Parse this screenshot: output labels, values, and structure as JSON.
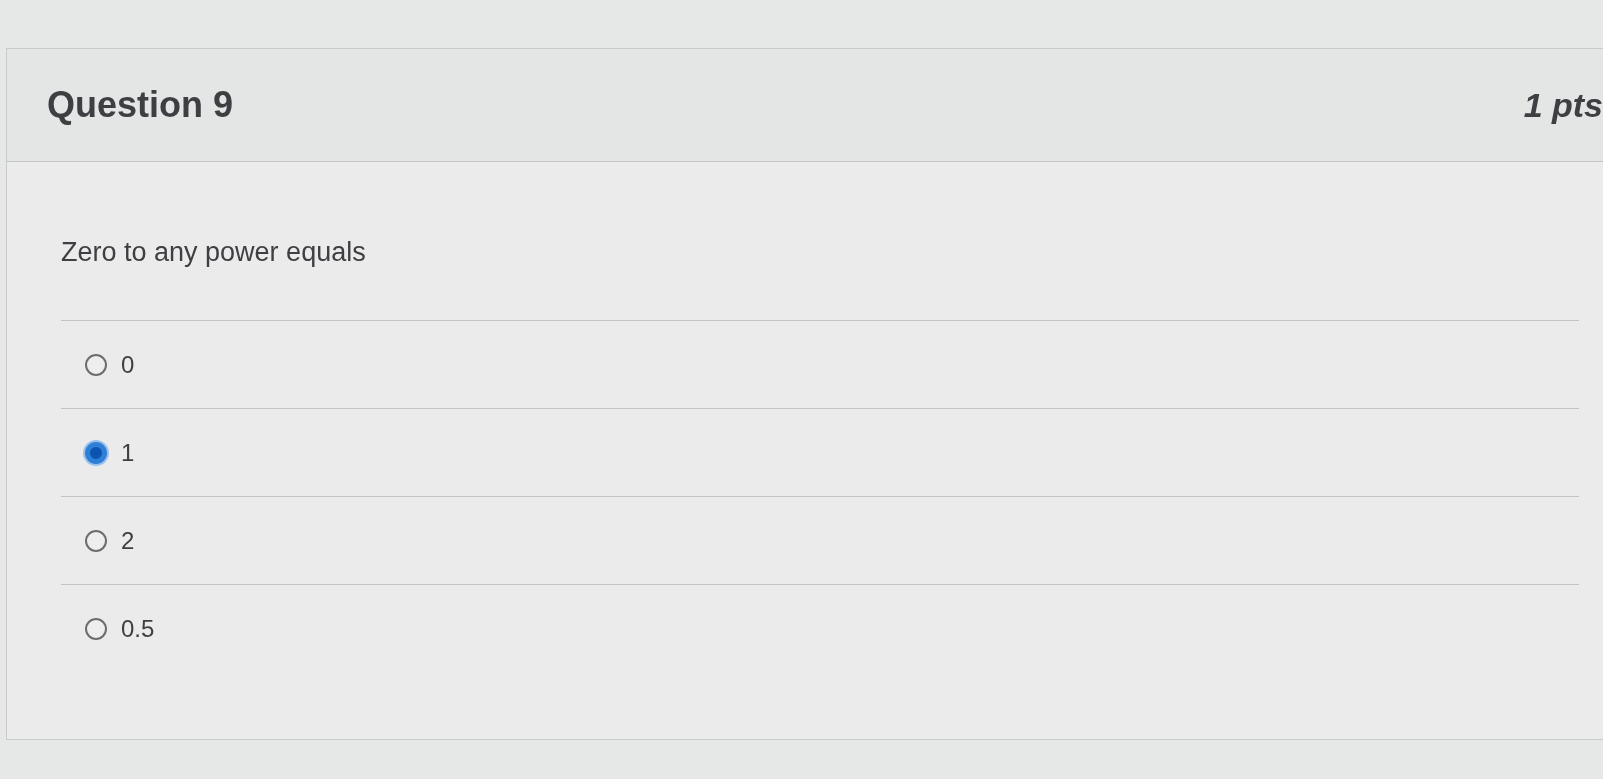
{
  "question": {
    "title": "Question 9",
    "points": "1 pts",
    "text": "Zero to any power equals",
    "answers": [
      {
        "label": "0",
        "selected": false
      },
      {
        "label": "1",
        "selected": true
      },
      {
        "label": "2",
        "selected": false
      },
      {
        "label": "0.5",
        "selected": false
      }
    ]
  }
}
